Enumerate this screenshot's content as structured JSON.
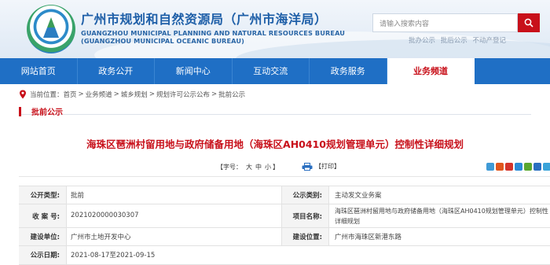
{
  "header": {
    "title_cn": "广州市规划和自然资源局（广州市海洋局）",
    "title_en_line1": "GUANGZHOU MUNICIPAL PLANNING AND NATURAL RESOURCES BUREAU",
    "title_en_line2": "(GUANGZHOU MUNICIPAL OCEANIC BUREAU)",
    "search_placeholder": "请输入搜索内容",
    "user_links": [
      "批办公示",
      "批后公示",
      "不动产登记"
    ]
  },
  "nav": {
    "items": [
      "网站首页",
      "政务公开",
      "新闻中心",
      "互动交流",
      "政务服务",
      "业务频道"
    ],
    "active_index": 5
  },
  "breadcrumb": {
    "label": "当前位置：",
    "items": [
      "首页",
      "业务频道",
      "城乡规划",
      "规划许可公示公布",
      "批前公示"
    ],
    "separator": ">"
  },
  "section": {
    "title": "批前公示"
  },
  "article": {
    "title": "海珠区琶洲村留用地与政府储备用地（海珠区AH0410规划管理单元）控制性详细规划"
  },
  "toolbar": {
    "open_bracket": "【",
    "font_label": "字号：",
    "sizes": [
      "大",
      "中",
      "小"
    ],
    "close_bracket": "】",
    "print_label": "打印"
  },
  "share_colors": [
    "#3f9ad6",
    "#e0561d",
    "#d4332b",
    "#2a8bd6",
    "#5aa72f",
    "#2a6fc0",
    "#3aa3d9"
  ],
  "info": {
    "rows": [
      {
        "k1": "公开类型:",
        "v1": "批前",
        "k2": "公示类别:",
        "v2": "主动发文业务案"
      },
      {
        "k1": "收 案 号:",
        "v1": "2021020000030307",
        "k2": "项目名称:",
        "v2_line1": "海珠区琶洲村留用地与政府储备用地（海珠区AH0410规划管理单元）控制性",
        "v2_line2": "详细规划"
      },
      {
        "k1": "建设单位:",
        "v1": "广州市土地开发中心",
        "k2": "建设位置:",
        "v2": "广州市海珠区新港东路"
      },
      {
        "k1": "公示日期:",
        "v1": "2021-08-17至2021-09-15"
      }
    ]
  }
}
